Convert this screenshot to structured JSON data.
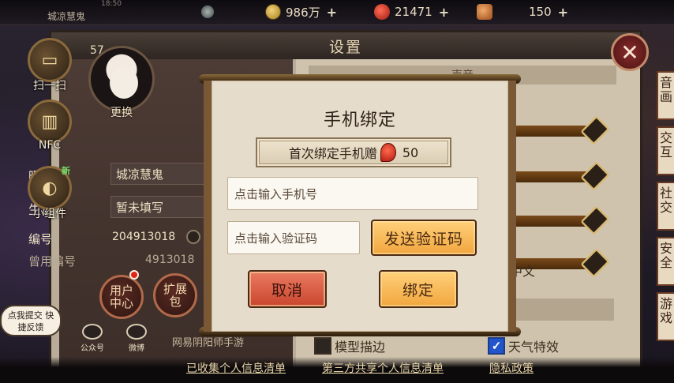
{
  "top_bar": {
    "player_name": "城凉慧鬼",
    "clock": "18:50",
    "resources": [
      {
        "icon": "coin-icon",
        "value": "986万"
      },
      {
        "icon": "gem-icon",
        "value": "21471"
      },
      {
        "icon": "food-icon",
        "value": "150"
      }
    ],
    "plus": "+"
  },
  "side_menu": [
    {
      "label": "扫一扫",
      "icon": "scan-icon"
    },
    {
      "label": "NFC",
      "icon": "nfc-icon"
    },
    {
      "label": "小组件",
      "icon": "widget-icon",
      "badge": "新"
    }
  ],
  "settings": {
    "title": "设置",
    "section": "声音",
    "profile": {
      "level": "57",
      "change_label": "更换",
      "nickname_label": "昵称",
      "nickname": "城凉慧鬼",
      "birthday_label": "生日",
      "birthday": "暂未填写",
      "id_label": "编号",
      "id": "204913018",
      "old_id_label": "曾用编号",
      "old_id": "4913018"
    },
    "buttons": {
      "user_center": "用户中心",
      "expansion": "扩展包"
    },
    "social": [
      {
        "label": "公众号",
        "icon": "wechat-icon"
      },
      {
        "label": "微博",
        "icon": "weibo-icon"
      }
    ],
    "netease_text": "网易阴阳师手游",
    "feedback": "点我提交 快捷反馈",
    "language": "中文",
    "checkboxes": [
      {
        "label": "模型描边",
        "checked": false
      },
      {
        "label": "天气特效",
        "checked": true
      }
    ],
    "right_tabs": [
      "音画",
      "交互",
      "社交",
      "安全",
      "游戏"
    ],
    "close_label": "✕"
  },
  "bottom_links": [
    "已收集个人信息清单",
    "第三方共享个人信息清单",
    "隐私政策"
  ],
  "modal": {
    "title": "手机绑定",
    "gift_text": "首次绑定手机赠",
    "gift_amount": "50",
    "phone_placeholder": "点击输入手机号",
    "code_placeholder": "点击输入验证码",
    "send_code": "发送验证码",
    "cancel": "取消",
    "bind": "绑定"
  },
  "colors": {
    "accent_orange": "#f1a63e",
    "cancel_red": "#c9452e",
    "parchment": "#e6dccb"
  }
}
